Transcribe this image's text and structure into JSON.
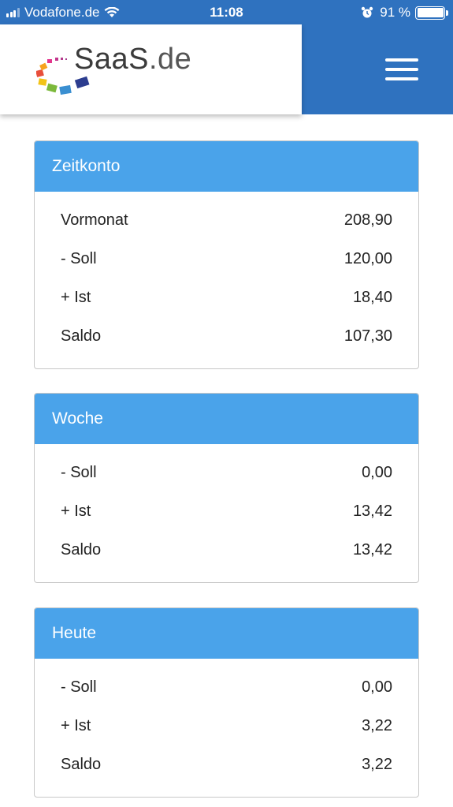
{
  "status_bar": {
    "carrier": "Vodafone.de",
    "time": "11:08",
    "battery": "91 %"
  },
  "header": {
    "logo_main": "SaaS",
    "logo_suffix": ".de",
    "brand_color": "#2f72bf"
  },
  "panels": [
    {
      "title": "Zeitkonto",
      "rows": [
        {
          "label": "Vormonat",
          "value": "208,90"
        },
        {
          "label": "- Soll",
          "value": "120,00"
        },
        {
          "label": "+ Ist",
          "value": "18,40"
        },
        {
          "label": "Saldo",
          "value": "107,30"
        }
      ]
    },
    {
      "title": "Woche",
      "rows": [
        {
          "label": "- Soll",
          "value": "0,00"
        },
        {
          "label": "+ Ist",
          "value": "13,42"
        },
        {
          "label": "Saldo",
          "value": "13,42"
        }
      ]
    },
    {
      "title": "Heute",
      "rows": [
        {
          "label": "- Soll",
          "value": "0,00"
        },
        {
          "label": "+ Ist",
          "value": "3,22"
        },
        {
          "label": "Saldo",
          "value": "3,22"
        }
      ]
    }
  ],
  "colors": {
    "panel_header": "#4aa3ea",
    "panel_border": "#c8c8c8"
  }
}
